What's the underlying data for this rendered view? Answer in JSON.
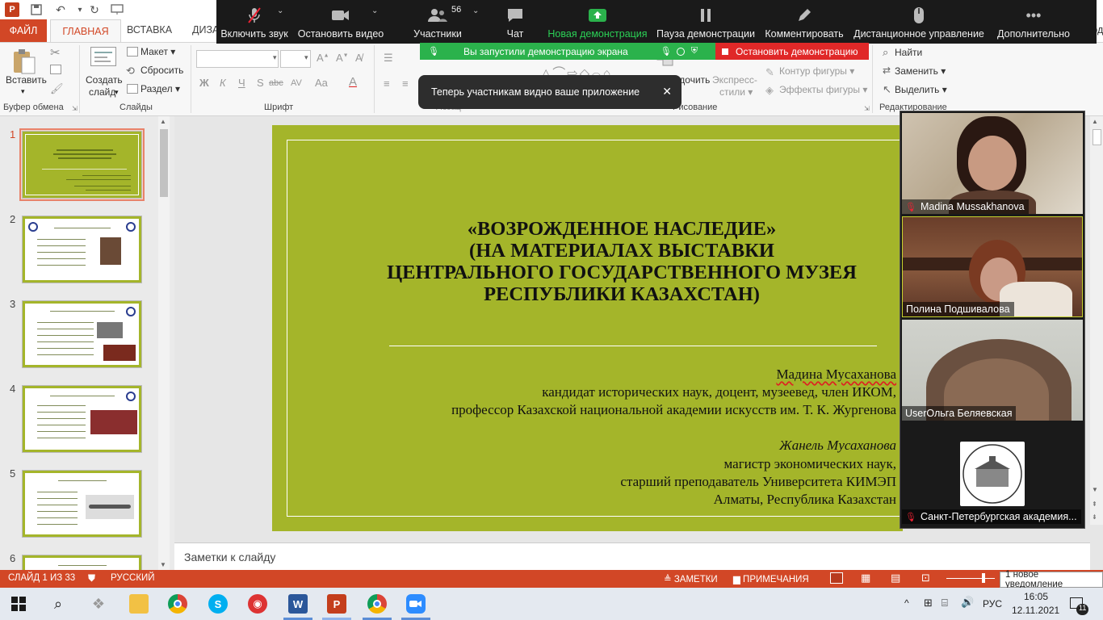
{
  "ribbon": {
    "file_tab": "ФАЙЛ",
    "home_tab": "ГЛАВНАЯ",
    "insert_tab": "ВСТАВКА",
    "design_tab_partial": "ДИЗА",
    "help_partial": "Вход",
    "paste": "Вставить",
    "new_slide_line1": "Создать",
    "new_slide_line2": "слайд",
    "layout": "Макет",
    "reset": "Сбросить",
    "section": "Раздел",
    "clipboard_group": "Буфер обмена",
    "slides_group": "Слайды",
    "font_group": "Шрифт",
    "paragraph_group": "Абзац",
    "drawing_group": "Рисование",
    "editing_group": "Редактирование",
    "arrange": "Упорядочить",
    "quick_styles_line1": "Экспресс-",
    "quick_styles_line2": "стили",
    "shape_outline": "Контур фигуры",
    "shape_effects": "Эффекты фигуры",
    "find": "Найти",
    "replace": "Заменить",
    "select": "Выделить",
    "font_glyphs": [
      "Ж",
      "К",
      "Ч",
      "S",
      "abc",
      "AV",
      "Aa",
      "A"
    ]
  },
  "zoom": {
    "unmute": "Включить звук",
    "stop_video": "Остановить видео",
    "participants": "Участники",
    "participants_count": "56",
    "chat": "Чат",
    "new_share": "Новая демонстрация",
    "pause_share": "Пауза демонстрации",
    "annotate": "Комментировать",
    "remote_control": "Дистанционное управление",
    "more": "Дополнительно",
    "sharing_status": "Вы запустили демонстрацию экрана",
    "stop_share": "Остановить демонстрацию",
    "toast": "Теперь участникам видно ваше приложение",
    "accent": "#2bb24c",
    "stop_color": "#e02828"
  },
  "thumbnails": [
    {
      "number": "1"
    },
    {
      "number": "2"
    },
    {
      "number": "3"
    },
    {
      "number": "4"
    },
    {
      "number": "5"
    },
    {
      "number": "6"
    }
  ],
  "slide": {
    "title_lines": [
      "«ВОЗРОЖДЕННОЕ НАСЛЕДИЕ»",
      "(НА МАТЕРИАЛАХ ВЫСТАВКИ",
      "ЦЕНТРАЛЬНОГО ГОСУДАРСТВЕННОГО МУЗЕЯ",
      "РЕСПУБЛИКИ КАЗАХСТАН)"
    ],
    "author1_name": "Мадина Мусаханова",
    "author1_line1": "кандидат исторических наук, доцент, музеевед, член ИКОМ,",
    "author1_line2": "профессор Казахской национальной академии искусств им.  Т. К. Жургенова",
    "author2_name": "Жанель Мусаханова",
    "author2_line1": "магистр экономических наук,",
    "author2_line2": "старший преподаватель Университета КИМЭП",
    "location": "Алматы, Республика Казахстан",
    "bg_color": "#a4b52a"
  },
  "notes_placeholder": "Заметки к слайду",
  "participants": [
    {
      "name": "Madina Mussakhanova"
    },
    {
      "name": "Полина Подшивалова"
    },
    {
      "name": "UserОльга Беляевская"
    },
    {
      "name": "Санкт-Петербургская академия..."
    }
  ],
  "status": {
    "slide_counter": "СЛАЙД 1 ИЗ 33",
    "language": "РУССКИЙ",
    "notes": "ЗАМЕТКИ",
    "comments": "ПРИМЕЧАНИЯ",
    "notification": "1 новое уведомление"
  },
  "taskbar": {
    "language": "РУС",
    "time": "16:05",
    "date": "12.11.2021",
    "notif_count": "11"
  }
}
